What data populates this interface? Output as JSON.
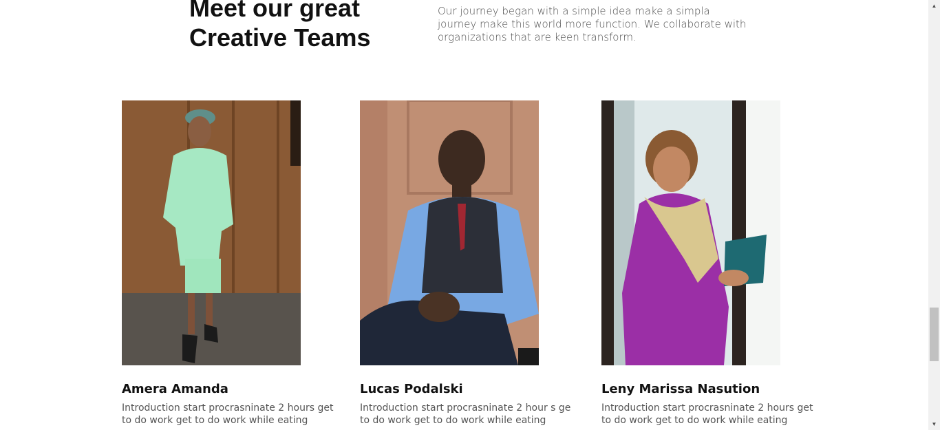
{
  "section": {
    "heading_line1": "Meet our great",
    "heading_line2": "Creative Teams",
    "intro": "Our journey began with a simple idea make a simpla journey make this world more function. We collaborate with organizations that are keen transform."
  },
  "team": [
    {
      "name": "Amera Amanda",
      "bio": "Introduction start procrasninate 2 hours get to do work get to do work while eating"
    },
    {
      "name": "Lucas Podalski",
      "bio": "Introduction start procrasninate 2 hour s ge to do work get to do work while eating"
    },
    {
      "name": "Leny Marissa Nasution",
      "bio": "Introduction start procrasninate 2 hours get to do work get to do work while eating"
    }
  ],
  "scrollbar": {
    "up_icon": "chevron-up-icon",
    "down_icon": "chevron-down-icon"
  }
}
